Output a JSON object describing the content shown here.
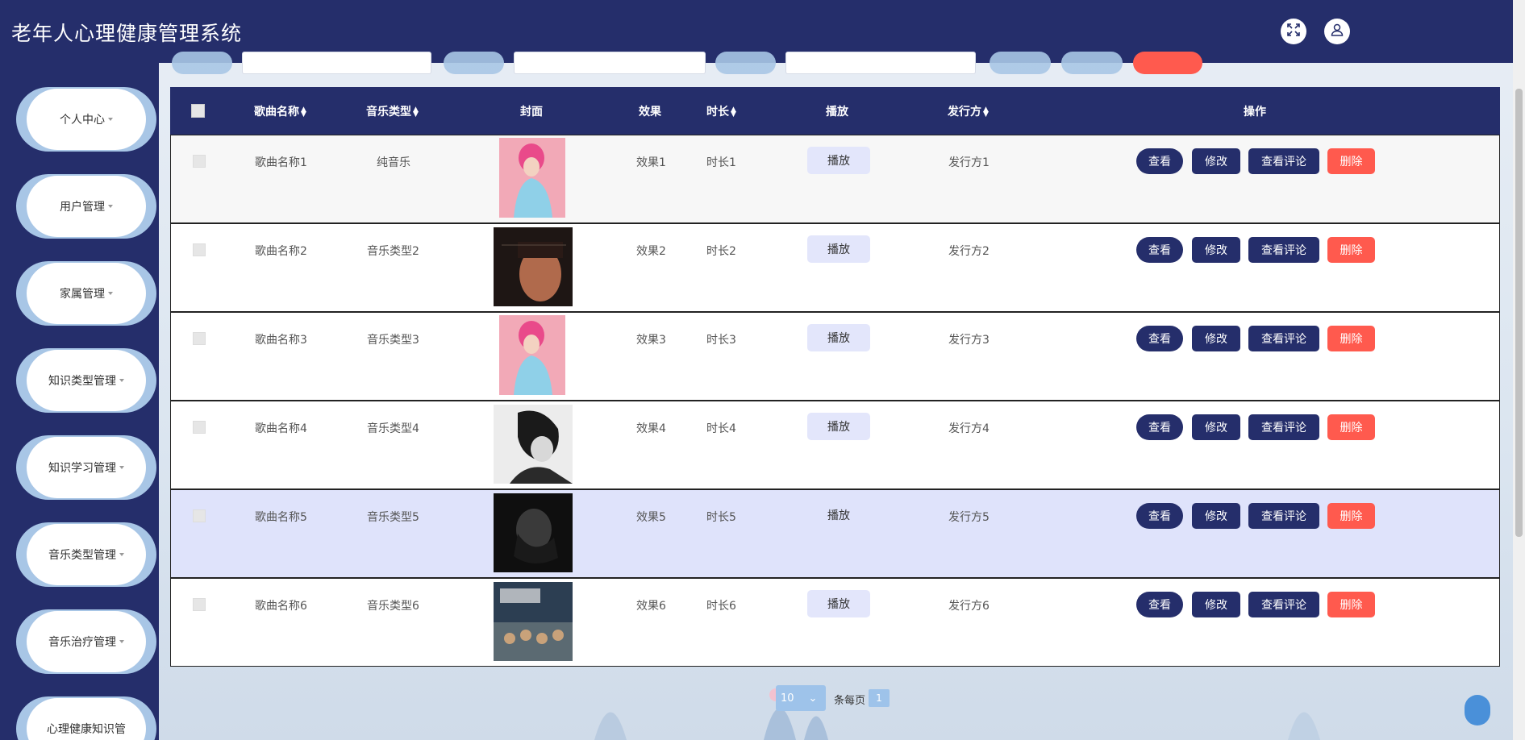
{
  "app": {
    "title": "老年人心理健康管理系统",
    "icons": [
      "fullscreen-icon",
      "user-icon"
    ]
  },
  "sidebar": {
    "items": [
      {
        "label": "个人中心"
      },
      {
        "label": "用户管理"
      },
      {
        "label": "家属管理"
      },
      {
        "label": "知识类型管理"
      },
      {
        "label": "知识学习管理"
      },
      {
        "label": "音乐类型管理"
      },
      {
        "label": "音乐治疗管理"
      },
      {
        "label": "心理健康知识管"
      }
    ]
  },
  "table": {
    "headers": {
      "name": "歌曲名称",
      "type": "音乐类型",
      "cover": "封面",
      "effect": "效果",
      "duration": "时长",
      "play": "播放",
      "publisher": "发行方",
      "actions": "操作"
    },
    "rows": [
      {
        "name": "歌曲名称1",
        "type": "纯音乐",
        "effect": "效果1",
        "duration": "时长1",
        "play": "播放",
        "publisher": "发行方1"
      },
      {
        "name": "歌曲名称2",
        "type": "音乐类型2",
        "effect": "效果2",
        "duration": "时长2",
        "play": "播放",
        "publisher": "发行方2"
      },
      {
        "name": "歌曲名称3",
        "type": "音乐类型3",
        "effect": "效果3",
        "duration": "时长3",
        "play": "播放",
        "publisher": "发行方3"
      },
      {
        "name": "歌曲名称4",
        "type": "音乐类型4",
        "effect": "效果4",
        "duration": "时长4",
        "play": "播放",
        "publisher": "发行方4"
      },
      {
        "name": "歌曲名称5",
        "type": "音乐类型5",
        "effect": "效果5",
        "duration": "时长5",
        "play": "播放",
        "publisher": "发行方5"
      },
      {
        "name": "歌曲名称6",
        "type": "音乐类型6",
        "effect": "效果6",
        "duration": "时长6",
        "play": "播放",
        "publisher": "发行方6"
      }
    ],
    "actions": {
      "view": "查看",
      "edit": "修改",
      "comments": "查看评论",
      "delete": "删除"
    }
  },
  "pagination": {
    "page_size": "10",
    "page_size_label": "条每页",
    "current_page": "1"
  },
  "colors": {
    "primary": "#252e6b",
    "danger": "#ff5a4e",
    "accent": "#a8c6e6",
    "highlight_row": "#dfe3fb"
  }
}
